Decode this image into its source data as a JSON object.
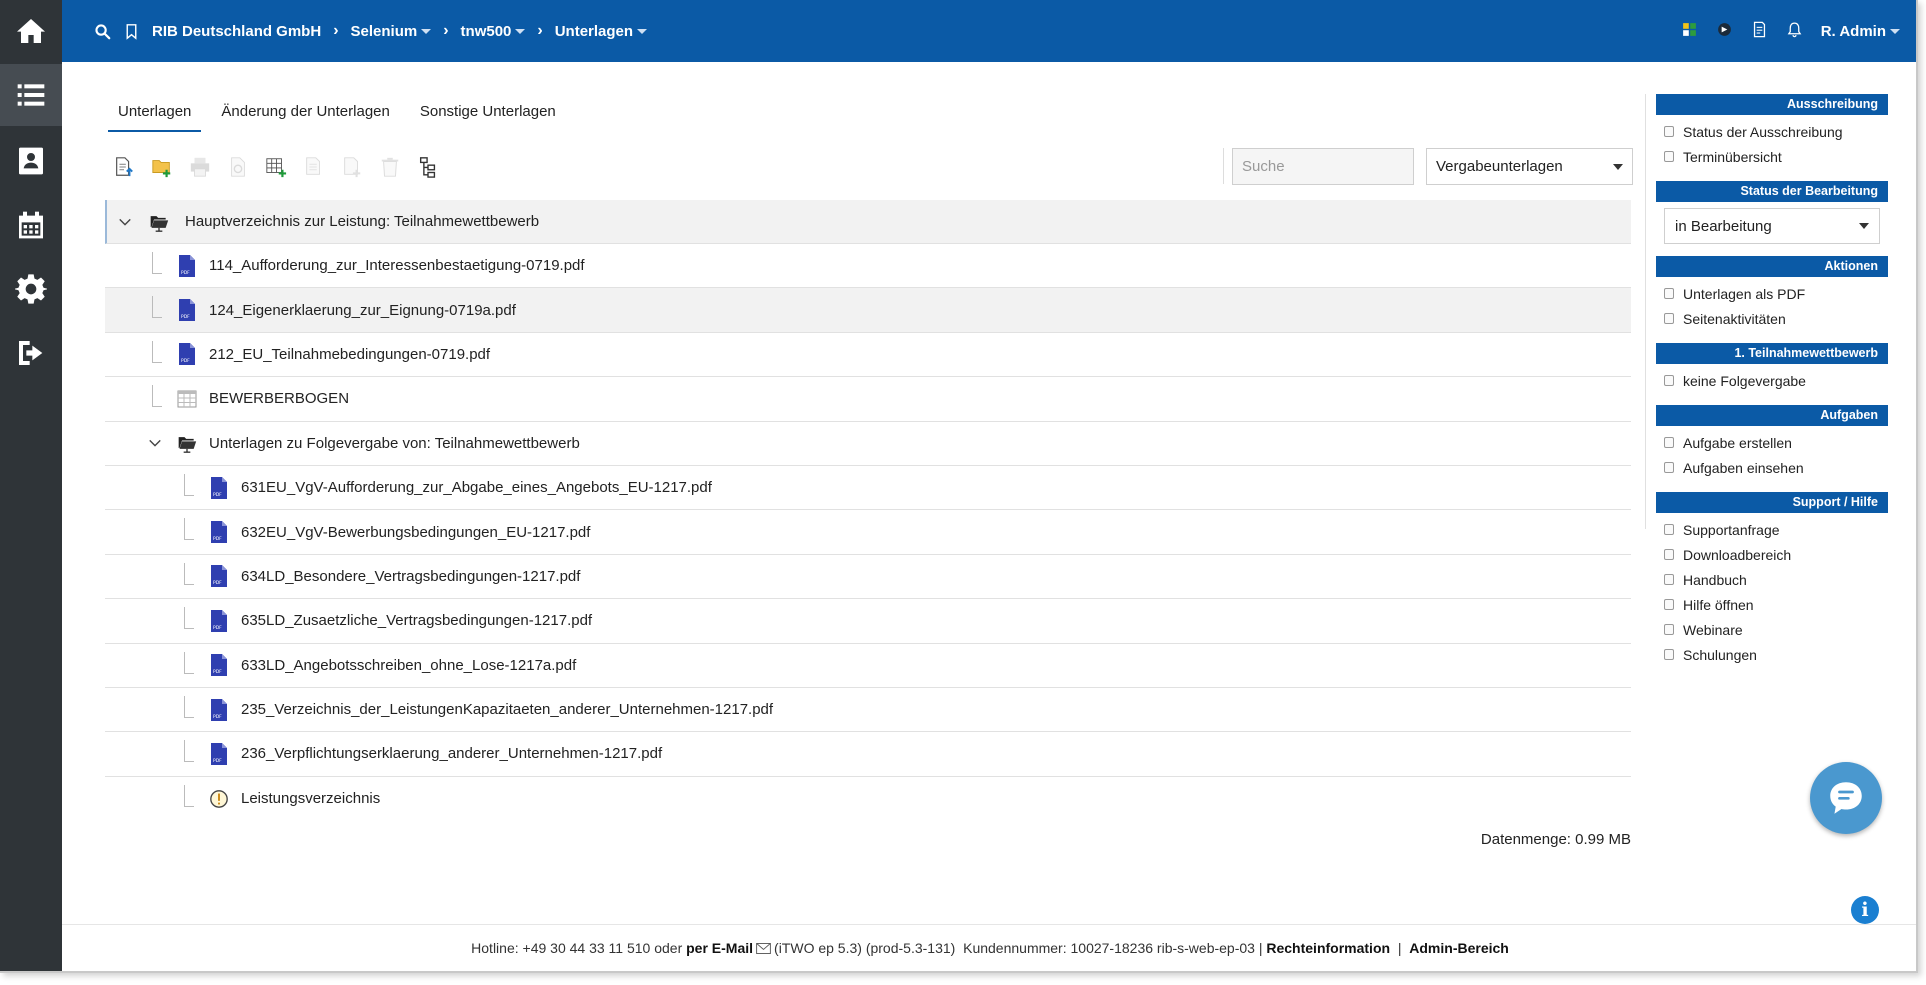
{
  "topbar": {
    "breadcrumbs": [
      {
        "label": "RIB Deutschland GmbH",
        "dropdown": false
      },
      {
        "label": "Selenium",
        "dropdown": true
      },
      {
        "label": "tnw500",
        "dropdown": true
      },
      {
        "label": "Unterlagen",
        "dropdown": true
      }
    ],
    "user": "R. Admin"
  },
  "leftnav": [
    "home-icon",
    "list-icon",
    "contacts-icon",
    "calendar-icon",
    "settings-icon",
    "logout-icon"
  ],
  "tabs": [
    {
      "label": "Unterlagen",
      "active": true
    },
    {
      "label": "Änderung der Unterlagen",
      "active": false
    },
    {
      "label": "Sonstige Unterlagen",
      "active": false
    }
  ],
  "toolbar": {
    "search_placeholder": "Suche",
    "filter_value": "Vergabeunterlagen"
  },
  "tree": {
    "root": "Hauptverzeichnis zur Leistung: Teilnahmewettbewerb",
    "items": [
      "114_Aufforderung_zur_Interessenbestaetigung-0719.pdf",
      "124_Eigenerklaerung_zur_Eignung-0719a.pdf",
      "212_EU_Teilnahmebedingungen-0719.pdf",
      "BEWERBERBOGEN"
    ],
    "subfolder": "Unterlagen zu Folgevergabe von: Teilnahmewettbewerb",
    "subitems": [
      "631EU_VgV-Aufforderung_zur_Abgabe_eines_Angebots_EU-1217.pdf",
      "632EU_VgV-Bewerbungsbedingungen_EU-1217.pdf",
      "634LD_Besondere_Vertragsbedingungen-1217.pdf",
      "635LD_Zusaetzliche_Vertragsbedingungen-1217.pdf",
      "633LD_Angebotsschreiben_ohne_Lose-1217a.pdf",
      "235_Verzeichnis_der_LeistungenKapazitaeten_anderer_Unternehmen-1217.pdf",
      "236_Verpflichtungserklaerung_anderer_Unternehmen-1217.pdf",
      "Leistungsverzeichnis"
    ]
  },
  "datenmenge": "Datenmenge: 0.99 MB",
  "sidebar": {
    "ausschreibung": {
      "title": "Ausschreibung",
      "links": [
        "Status der Ausschreibung",
        "Terminübersicht"
      ]
    },
    "status": {
      "title": "Status der Bearbeitung",
      "value": "in Bearbeitung"
    },
    "aktionen": {
      "title": "Aktionen",
      "links": [
        "Unterlagen als PDF",
        "Seitenaktivitäten"
      ]
    },
    "teilnahme": {
      "title": "1. Teilnahmewettbewerb",
      "links": [
        "keine Folgevergabe"
      ]
    },
    "aufgaben": {
      "title": "Aufgaben",
      "links": [
        "Aufgabe erstellen",
        "Aufgaben einsehen"
      ]
    },
    "support": {
      "title": "Support / Hilfe",
      "links": [
        "Supportanfrage",
        "Downloadbereich",
        "Handbuch",
        "Hilfe öffnen",
        "Webinare",
        "Schulungen"
      ]
    }
  },
  "footer": {
    "hotline": "Hotline: +49 30 44 33 11 510 oder",
    "email": "per E-Mail",
    "version": "(iTWO ep 5.3) (prod-5.3-131)",
    "customer": "Kundennummer: 10027-18236 rib-s-web-ep-03 |",
    "rechte": "Rechteinformation",
    "sep": "|",
    "admin": "Admin-Bereich"
  },
  "colors": {
    "brand": "#0b5aa6",
    "nav": "#2f3438",
    "pdf": "#2f3fb0"
  }
}
